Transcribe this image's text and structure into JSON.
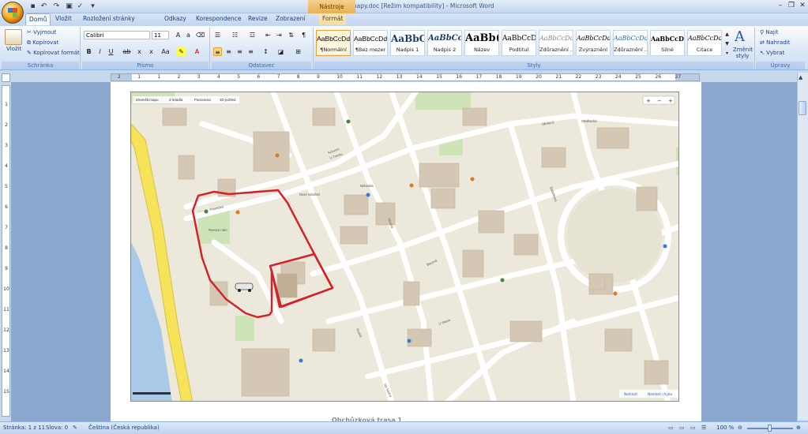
{
  "window": {
    "title": "obchůzkové mapy.doc [Režim kompatibility] - Microsoft Word",
    "contextual_tools": "Nástroje obrázků"
  },
  "tabs": [
    "Domů",
    "Vložit",
    "Rozložení stránky",
    "Odkazy",
    "Korespondence",
    "Revize",
    "Zobrazení",
    "Formát"
  ],
  "ribbon": {
    "clipboard": {
      "paste": "Vložit",
      "cut": "Vyjmout",
      "copy": "Kopírovat",
      "format_painter": "Kopírovat formát",
      "group": "Schránka"
    },
    "font": {
      "name": "Calibri",
      "size": "11",
      "group": "Písmo"
    },
    "paragraph": {
      "group": "Odstavec"
    },
    "styles": {
      "group": "Styly",
      "items": [
        {
          "sample": "AaBbCcDd",
          "name": "¶Normální"
        },
        {
          "sample": "AaBbCcDd",
          "name": "¶Bez mezer"
        },
        {
          "sample": "AaBbC",
          "name": "Nadpis 1"
        },
        {
          "sample": "AaBbCc",
          "name": "Nadpis 2"
        },
        {
          "sample": "AaBb(",
          "name": "Název"
        },
        {
          "sample": "AaBbCcD",
          "name": "Podtitul"
        },
        {
          "sample": "AaBbCcDd",
          "name": "Zdůraznění ..."
        },
        {
          "sample": "AaBbCcDd",
          "name": "Zvýraznění"
        },
        {
          "sample": "AaBbCcDd",
          "name": "Zdůraznění ..."
        },
        {
          "sample": "AaBbCcDc",
          "name": "Silné"
        },
        {
          "sample": "AaBbCcDd",
          "name": "Citace"
        }
      ],
      "change_styles": "Změnit styly"
    },
    "editing": {
      "find": "Najít",
      "replace": "Nahradit",
      "select": "Vybrat",
      "group": "Úpravy"
    }
  },
  "ruler": {
    "h_ticks": [
      "2",
      "1",
      "1",
      "2",
      "3",
      "4",
      "5",
      "6",
      "7",
      "8",
      "9",
      "10",
      "11",
      "12",
      "13",
      "14",
      "15",
      "16",
      "17",
      "18",
      "19",
      "20",
      "21",
      "22",
      "23",
      "24",
      "25",
      "26",
      "27"
    ],
    "v_ticks": [
      "1",
      "2",
      "3",
      "4",
      "5",
      "6",
      "7",
      "8",
      "9",
      "10",
      "11",
      "12",
      "13",
      "14",
      "15"
    ]
  },
  "map": {
    "toolbar": [
      "Zmenšit mapu",
      "Z letadla",
      "Panorama",
      "3D pohled"
    ],
    "streets": [
      "Korunní",
      "Obránců",
      "Nebeská",
      "Bazová",
      "Studná",
      "U Trenku",
      "Strašnická",
      "Kounická",
      "Šafaříkova",
      "Ruská",
      "U Slavie",
      "Na Sádce",
      "Nové náměstí",
      "Rusovo nám."
    ],
    "highlight_color": "#d2232a",
    "bottom_links": [
      "Nahlásit",
      "Nahlásit chybu"
    ]
  },
  "caption": "Obchůzková trasa 1",
  "status": {
    "page": "Stránka: 1 z 11",
    "words": "Slova: 0",
    "language": "Čeština (Česká republika)",
    "zoom": "100 %"
  }
}
